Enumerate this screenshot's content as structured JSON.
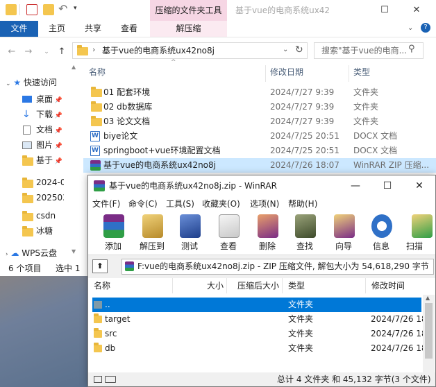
{
  "explorer": {
    "window_title": "基于vue的电商系统ux42",
    "context_tab_header": "压缩的文件夹工具",
    "ribbon_tabs": [
      "文件",
      "主页",
      "共享",
      "查看",
      "解压缩"
    ],
    "breadcrumb": "基于vue的电商系统ux42no8j",
    "search_placeholder": "搜索\"基于vue的电商...",
    "sidebar": [
      {
        "label": "快速访问",
        "icon": "star-icon"
      },
      {
        "label": "桌面",
        "icon": "desktop-icon"
      },
      {
        "label": "下载",
        "icon": "download-icon"
      },
      {
        "label": "文档",
        "icon": "document-icon"
      },
      {
        "label": "图片",
        "icon": "picture-icon"
      },
      {
        "label": "基于",
        "icon": "folder-icon"
      },
      {
        "label": "2024-0",
        "icon": "folder-icon"
      },
      {
        "label": "202503",
        "icon": "folder-icon"
      },
      {
        "label": "csdn",
        "icon": "folder-icon"
      },
      {
        "label": "冰糖",
        "icon": "folder-icon"
      },
      {
        "label": "WPS云盘",
        "icon": "cloud-icon"
      }
    ],
    "columns": {
      "name": "名称",
      "date": "修改日期",
      "type": "类型"
    },
    "files": [
      {
        "name": "01 配套环境",
        "date": "2024/7/27 9:39",
        "type": "文件夹",
        "icon": "folder-icon"
      },
      {
        "name": "02 db数据库",
        "date": "2024/7/27 9:39",
        "type": "文件夹",
        "icon": "folder-icon"
      },
      {
        "name": "03 论文文档",
        "date": "2024/7/27 9:39",
        "type": "文件夹",
        "icon": "folder-icon"
      },
      {
        "name": "biye论文",
        "date": "2024/7/25 20:51",
        "type": "DOCX 文档",
        "icon": "word-icon"
      },
      {
        "name": "springboot+vue环境配置文档",
        "date": "2024/7/25 20:51",
        "type": "DOCX 文档",
        "icon": "word-icon"
      },
      {
        "name": "基于vue的电商系统ux42no8j",
        "date": "2024/7/26 18:07",
        "type": "WinRAR ZIP 压缩...",
        "icon": "winrar-icon"
      }
    ],
    "status": {
      "count": "6 个项目",
      "selected": "选中 1"
    }
  },
  "winrar": {
    "title": "基于vue的电商系统ux42no8j.zip - WinRAR",
    "menu": [
      {
        "label": "文件(F)"
      },
      {
        "label": "命令(C)"
      },
      {
        "label": "工具(S)"
      },
      {
        "label": "收藏夹(O)"
      },
      {
        "label": "选项(N)"
      },
      {
        "label": "帮助(H)"
      }
    ],
    "toolbar": [
      "添加",
      "解压到",
      "测试",
      "查看",
      "删除",
      "查找",
      "向导",
      "信息",
      "扫描"
    ],
    "path": "F:vue的电商系统ux42no8j.zip - ZIP 压缩文件, 解包大小为 54,618,290 字节",
    "columns": {
      "name": "名称",
      "size": "大小",
      "packed": "压缩后大小",
      "type": "类型",
      "modified": "修改时间"
    },
    "rows": [
      {
        "name": "..",
        "type": "文件夹",
        "modified": ""
      },
      {
        "name": "target",
        "type": "文件夹",
        "modified": "2024/7/26 18"
      },
      {
        "name": "src",
        "type": "文件夹",
        "modified": "2024/7/26 18"
      },
      {
        "name": "db",
        "type": "文件夹",
        "modified": "2024/7/26 18"
      }
    ],
    "status": "总计 4 文件夹 和 45,132 字节(3 个文件)"
  }
}
